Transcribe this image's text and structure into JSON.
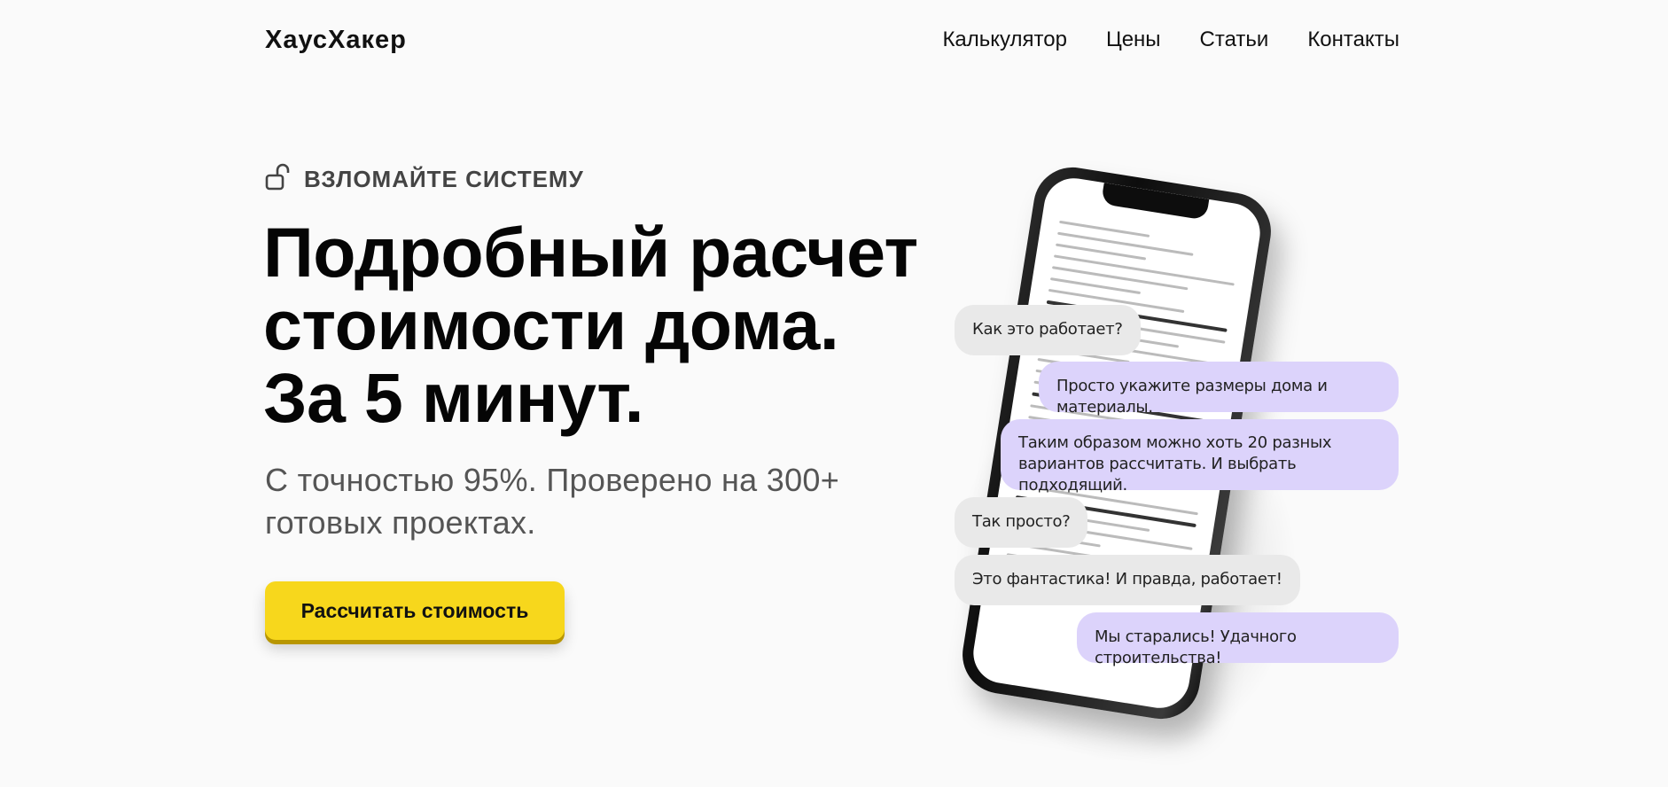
{
  "header": {
    "logo": "ХаусХакер",
    "nav": [
      "Калькулятор",
      "Цены",
      "Статьи",
      "Контакты"
    ]
  },
  "hero": {
    "eyebrow": "ВЗЛОМАЙТЕ СИСТЕМУ",
    "headline": [
      "Подробный расчет",
      "стоимости дома.",
      "За 5 минут."
    ],
    "subtitle": [
      "С точностью 95%. Проверено на 300+",
      "готовых проектах."
    ],
    "cta_label": "Рассчитать стоимость"
  },
  "chat": [
    {
      "side": "left",
      "style": "gray",
      "text": "Как это работает?"
    },
    {
      "side": "right",
      "style": "purple",
      "text": "Просто укажите размеры дома и материалы."
    },
    {
      "side": "right",
      "style": "purple",
      "text": "Таким образом можно хоть 20 разных вариантов рассчитать. И выбрать подходящий."
    },
    {
      "side": "left",
      "style": "gray",
      "text": "Так просто?"
    },
    {
      "side": "left",
      "style": "gray",
      "text": "Это фантастика! И правда, работает!"
    },
    {
      "side": "right",
      "style": "purple",
      "text": "Мы старались! Удачного строительства!"
    }
  ],
  "colors": {
    "accent": "#f7d71c",
    "bubble_user": "#e9e9e9",
    "bubble_reply": "#dcd3fb",
    "background": "#fafafa"
  },
  "icons": {
    "eyebrow_icon": "unlocked-lock-icon"
  }
}
